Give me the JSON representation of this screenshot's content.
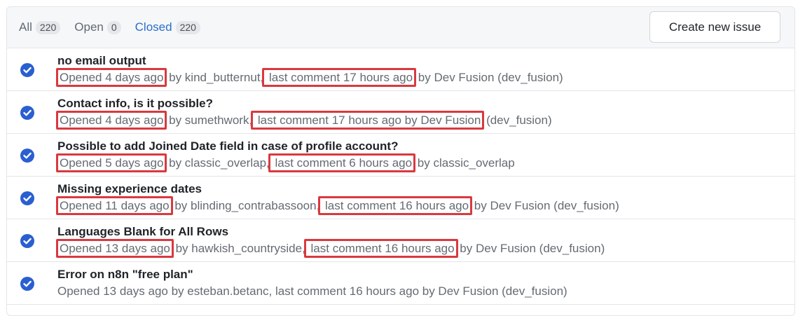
{
  "tabs": [
    {
      "label": "All",
      "count": "220"
    },
    {
      "label": "Open",
      "count": "0"
    },
    {
      "label": "Closed",
      "count": "220"
    }
  ],
  "create_button_label": "Create new issue",
  "issues": [
    {
      "title": "no email output",
      "opened": "Opened 4 days ago",
      "by_author": " by kind_butternut,",
      "last_comment": " last comment 17 hours ago",
      "by_commenter": " by Dev Fusion (dev_fusion)"
    },
    {
      "title": "Contact info, is it possible?",
      "opened": "Opened 4 days ago",
      "by_author": " by sumethwork,",
      "last_comment": " last comment 17 hours ago by Dev Fusion",
      "by_commenter": " (dev_fusion)"
    },
    {
      "title": "Possible to add Joined Date field in case of profile account?",
      "opened": "Opened 5 days ago",
      "by_author": " by classic_overlap,",
      "last_comment": " last comment 6 hours ago",
      "by_commenter": " by classic_overlap"
    },
    {
      "title": "Missing experience dates",
      "opened": "Opened 11 days ago",
      "by_author": " by blinding_contrabassoon,",
      "last_comment": " last comment 16 hours ago",
      "by_commenter": " by Dev Fusion (dev_fusion)"
    },
    {
      "title": "Languages Blank for All Rows",
      "opened": "Opened 13 days ago",
      "by_author": " by hawkish_countryside,",
      "last_comment": " last comment 16 hours ago",
      "by_commenter": " by Dev Fusion (dev_fusion)"
    },
    {
      "title": "Error on n8n \"free plan\"",
      "opened": "Opened 13 days ago",
      "by_author": " by esteban.betanc,",
      "last_comment": " last comment 16 hours ago",
      "by_commenter": " by Dev Fusion (dev_fusion)"
    }
  ],
  "colors": {
    "status_closed": "#2a5fd1",
    "highlight": "#d9393f",
    "active_tab": "#2a6fc9"
  },
  "icons": {
    "status": "check-circle-icon"
  }
}
